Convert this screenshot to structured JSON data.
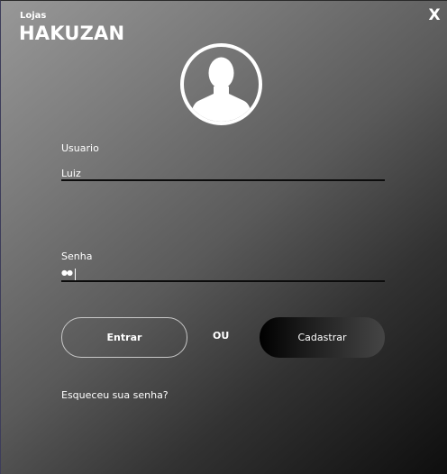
{
  "brand": {
    "subtitle": "Lojas",
    "title": "HAKUZAN"
  },
  "window": {
    "close_label": "X"
  },
  "form": {
    "username_label": "Usuario",
    "username_value": "Luiz",
    "password_label": "Senha",
    "password_value": "●●",
    "submit_label": "Entrar",
    "separator_label": "OU",
    "register_label": "Cadastrar",
    "forgot_label": "Esqueceu sua senha?"
  },
  "icons": {
    "avatar": "user-avatar-icon",
    "close": "close-icon"
  },
  "colors": {
    "accent_dark": "#000000",
    "text": "#ffffff",
    "underline": "#0c0c0c"
  }
}
